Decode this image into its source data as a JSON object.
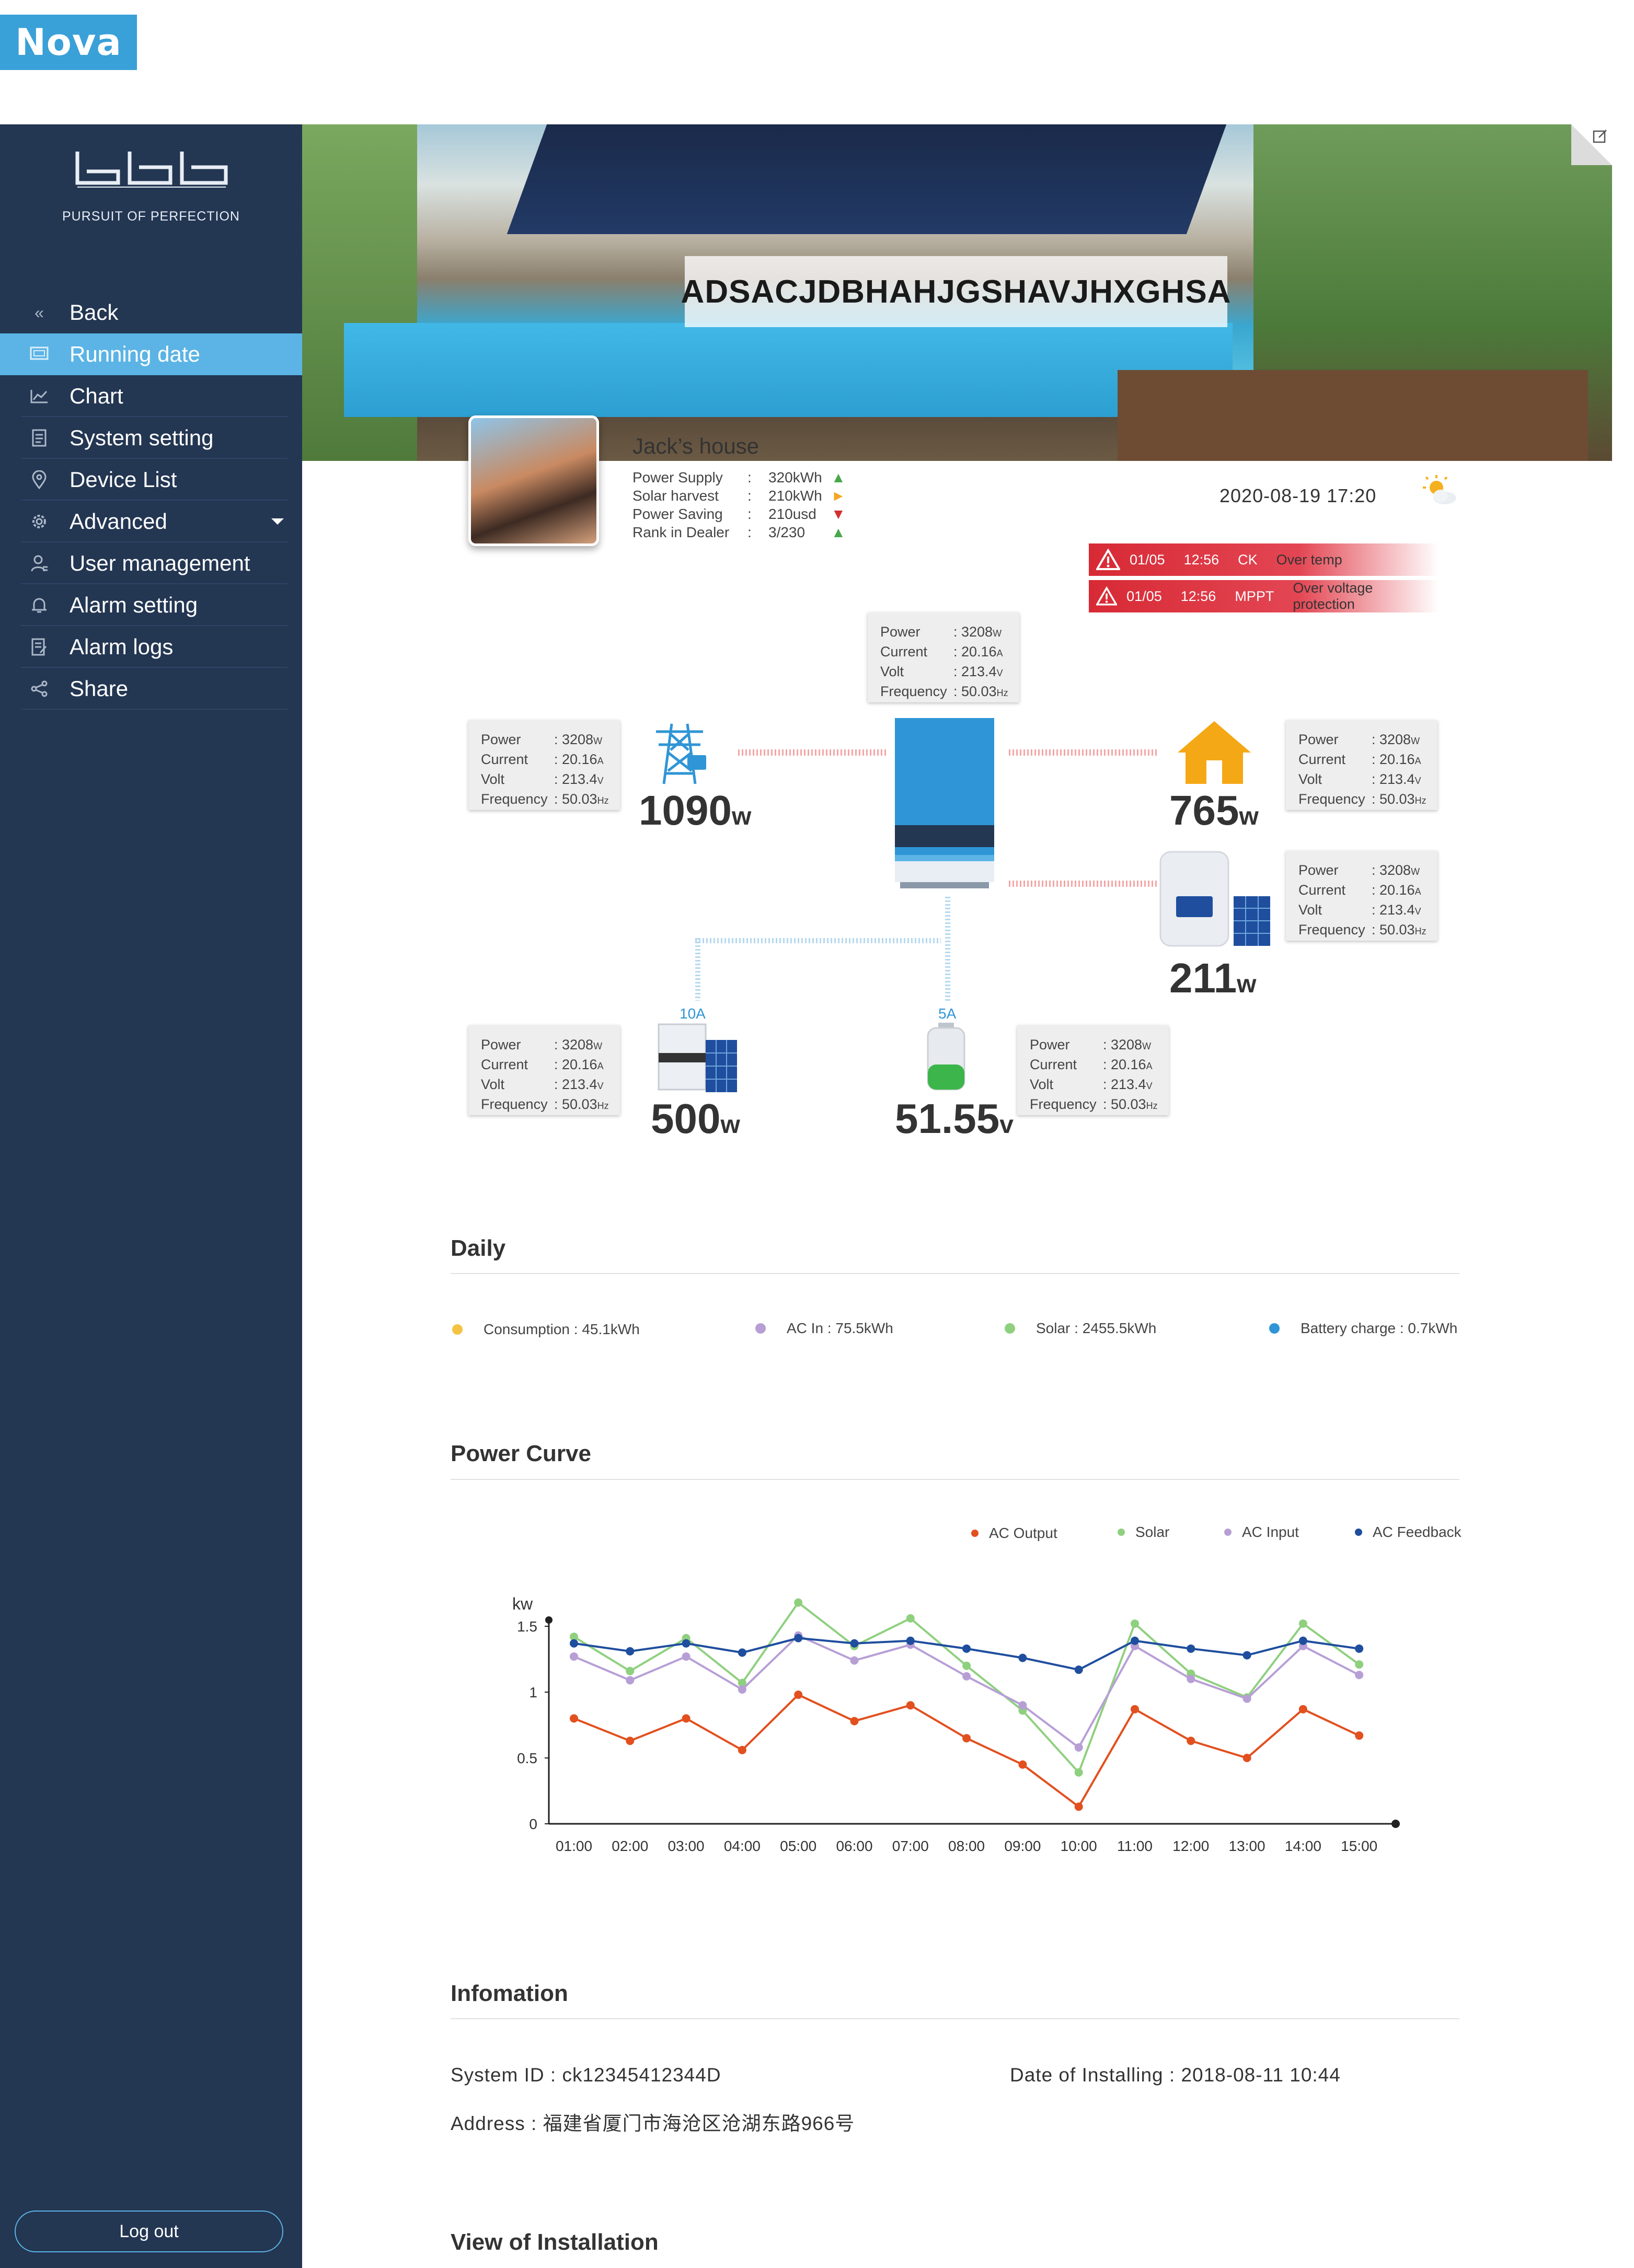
{
  "app": {
    "brand": "Nova",
    "tagline": "PURSUIT OF PERFECTION"
  },
  "sidebar": {
    "items": [
      {
        "label": "Back",
        "icon": "chevrons-left-icon"
      },
      {
        "label": "Running date",
        "icon": "monitor-icon",
        "active": true
      },
      {
        "label": "Chart",
        "icon": "line-chart-icon"
      },
      {
        "label": "System setting",
        "icon": "document-icon"
      },
      {
        "label": "Device List",
        "icon": "location-pin-icon"
      },
      {
        "label": "Advanced",
        "icon": "gear-icon"
      },
      {
        "label": "User management",
        "icon": "user-icon"
      },
      {
        "label": "Alarm setting",
        "icon": "bell-icon"
      },
      {
        "label": "Alarm logs",
        "icon": "log-icon"
      },
      {
        "label": "Share",
        "icon": "share-icon"
      }
    ],
    "logout": "Log out"
  },
  "hero": {
    "title": "ADSACJDBHAHJGSHAVJHXGHSA"
  },
  "profile": {
    "house_name": "Jack’s house",
    "stats": [
      {
        "key": "Power Supply",
        "value": "320kWh",
        "trend": "up"
      },
      {
        "key": "Solar harvest",
        "value": "210kWh",
        "trend": "right"
      },
      {
        "key": "Power Saving",
        "value": "210usd",
        "trend": "down"
      },
      {
        "key": "Rank in Dealer",
        "value": "3/230",
        "trend": "up"
      }
    ],
    "datetime": "2020-08-19 17:20"
  },
  "alarms": [
    {
      "date": "01/05",
      "time": "12:56",
      "source": "CK",
      "message": "Over temp"
    },
    {
      "date": "01/05",
      "time": "12:56",
      "source": "MPPT",
      "message": "Over voltage protection"
    }
  ],
  "infobox": {
    "power_key": "Power",
    "power_val": ": 3208",
    "power_unit": "W",
    "current_key": "Current",
    "current_val": ": 20.16",
    "current_unit": "A",
    "volt_key": "Volt",
    "volt_val": ": 213.4",
    "volt_unit": "V",
    "freq_key": "Frequency",
    "freq_val": ": 50.03",
    "freq_unit": "Hz"
  },
  "flow": {
    "grid": {
      "value": "1090",
      "unit": "w"
    },
    "home": {
      "value": "765",
      "unit": "w"
    },
    "pv_inverter": {
      "value": "211",
      "unit": "w"
    },
    "solar": {
      "value": "500",
      "unit": "w",
      "current": "10A"
    },
    "battery": {
      "value": "51.55",
      "unit": "v",
      "current": "5A"
    }
  },
  "daily": {
    "title": "Daily",
    "items": [
      {
        "label": "Consumption : 45.1kWh",
        "color": "#f5c342"
      },
      {
        "label": "AC In : 75.5kWh",
        "color": "#b79fd6"
      },
      {
        "label": "Solar : 2455.5kWh",
        "color": "#8fd07f"
      },
      {
        "label": "Battery charge : 0.7kWh",
        "color": "#2f95d6"
      }
    ]
  },
  "power_curve": {
    "title": "Power Curve"
  },
  "chart_data": {
    "type": "line",
    "title": "",
    "xlabel": "",
    "ylabel": "kw",
    "ylim": [
      0,
      1.5
    ],
    "yticks": [
      "0",
      "0.5",
      "1",
      "1.5"
    ],
    "categories": [
      "01:00",
      "02:00",
      "03:00",
      "04:00",
      "05:00",
      "06:00",
      "07:00",
      "08:00",
      "09:00",
      "10:00",
      "11:00",
      "12:00",
      "13:00",
      "14:00",
      "15:00"
    ],
    "series": [
      {
        "name": "AC Output",
        "color": "#e2501f",
        "values": [
          0.8,
          0.63,
          0.8,
          0.56,
          0.98,
          0.78,
          0.9,
          0.65,
          0.45,
          0.13,
          0.87,
          0.63,
          0.5,
          0.87,
          0.67
        ]
      },
      {
        "name": "Solar",
        "color": "#8fd07f",
        "values": [
          1.42,
          1.16,
          1.41,
          1.07,
          1.68,
          1.35,
          1.56,
          1.2,
          0.86,
          0.39,
          1.52,
          1.14,
          0.96,
          1.52,
          1.21
        ]
      },
      {
        "name": "AC Input",
        "color": "#b79fd6",
        "values": [
          1.27,
          1.09,
          1.27,
          1.02,
          1.43,
          1.24,
          1.36,
          1.12,
          0.9,
          0.58,
          1.35,
          1.1,
          0.95,
          1.35,
          1.13
        ]
      },
      {
        "name": "AC Feedback",
        "color": "#1f4e9e",
        "values": [
          1.37,
          1.31,
          1.37,
          1.3,
          1.41,
          1.37,
          1.39,
          1.33,
          1.26,
          1.17,
          1.39,
          1.33,
          1.28,
          1.39,
          1.33
        ]
      }
    ]
  },
  "information": {
    "title": "Infomation",
    "system_id": "System ID : ck12345412344D",
    "date_installing": "Date of Installing : 2018-08-11 10:44",
    "address": "Address : 福建省厦门市海沧区沧湖东路966号"
  },
  "view_installation": {
    "title": "View of Installation"
  }
}
